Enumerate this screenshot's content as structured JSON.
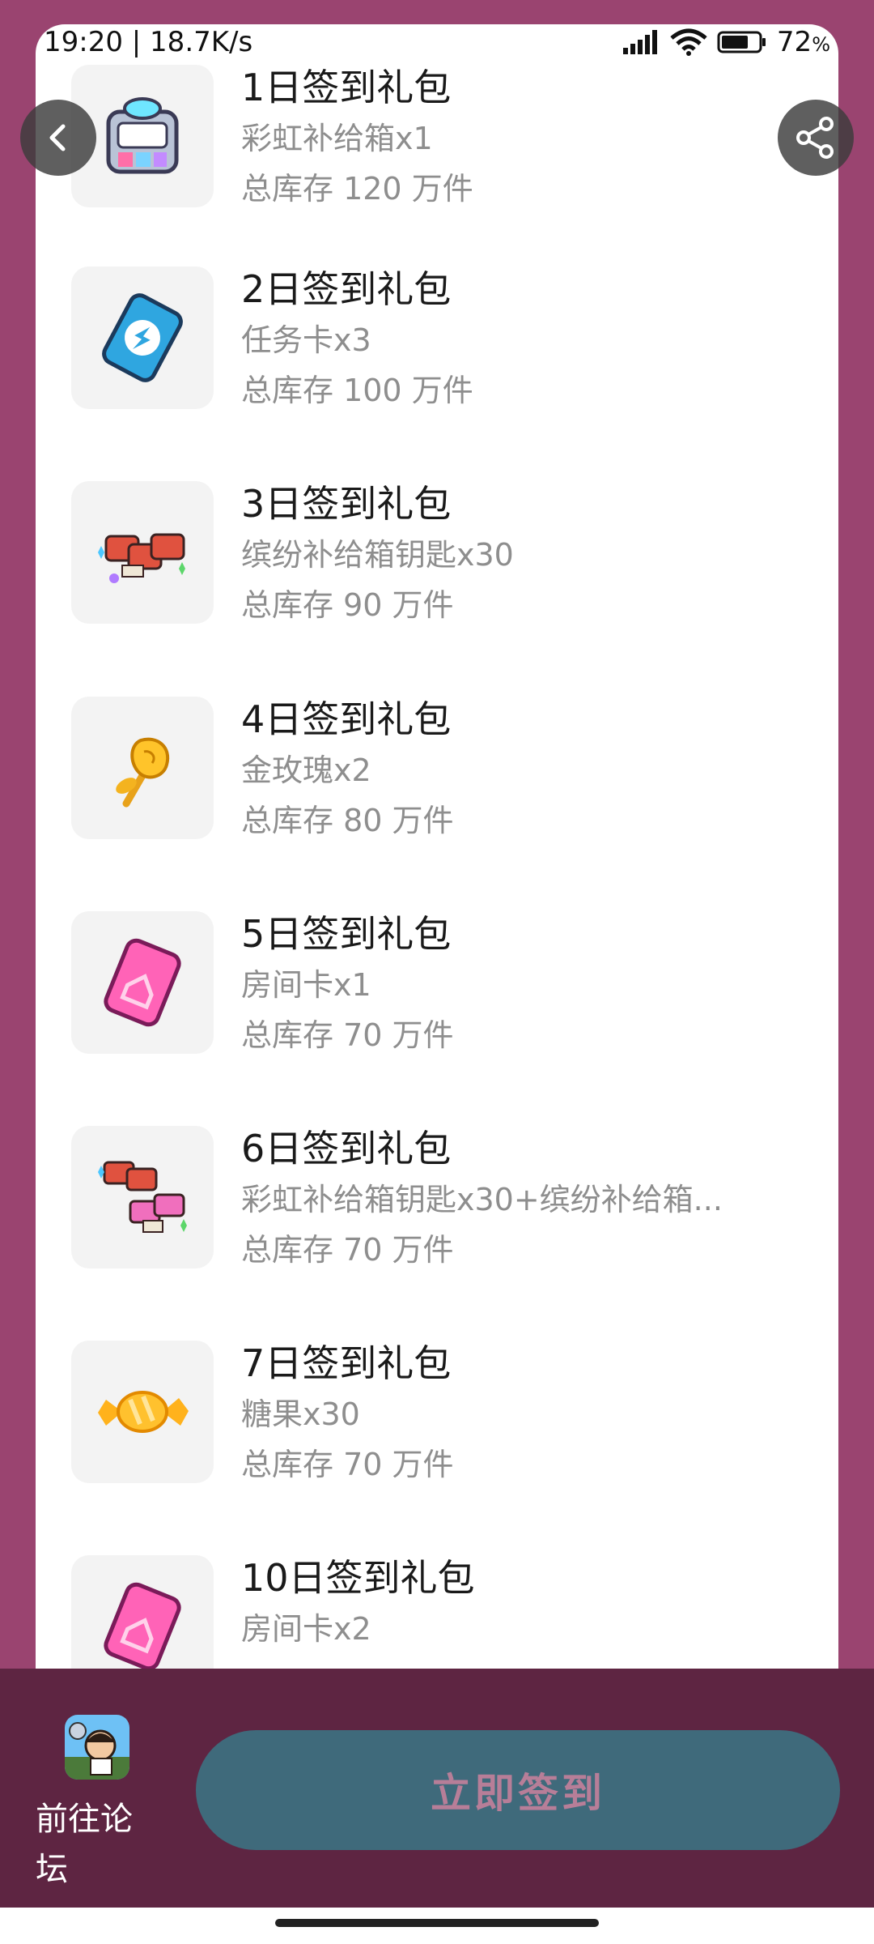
{
  "status_bar": {
    "time_speed": "19:20 | 18.7K/s",
    "battery": "72",
    "battery_unit": "%"
  },
  "gifts": [
    {
      "title": "1日签到礼包",
      "desc": "彩虹补给箱x1",
      "stock": "总库存 120 万件",
      "icon": "rainbow-supply-box-icon"
    },
    {
      "title": "2日签到礼包",
      "desc": "任务卡x3",
      "stock": "总库存 100 万件",
      "icon": "task-card-icon"
    },
    {
      "title": "3日签到礼包",
      "desc": "缤纷补给箱钥匙x30",
      "stock": "总库存 90 万件",
      "icon": "colorful-supply-key-icon"
    },
    {
      "title": "4日签到礼包",
      "desc": "金玫瑰x2",
      "stock": "总库存 80 万件",
      "icon": "golden-rose-icon"
    },
    {
      "title": "5日签到礼包",
      "desc": "房间卡x1",
      "stock": "总库存 70 万件",
      "icon": "room-card-icon"
    },
    {
      "title": "6日签到礼包",
      "desc": "彩虹补给箱钥匙x30+缤纷补给箱...",
      "stock": "总库存 70 万件",
      "icon": "supply-key-bundle-icon"
    },
    {
      "title": "7日签到礼包",
      "desc": "糖果x30",
      "stock": "总库存 70 万件",
      "icon": "candy-icon"
    },
    {
      "title": "10日签到礼包",
      "desc": "房间卡x2",
      "stock": "",
      "icon": "room-card-icon"
    }
  ],
  "bottom": {
    "forum_label": "前往论坛",
    "signin_label": "立即签到"
  },
  "colors": {
    "background": "#9a4470",
    "bottom_bar": "#5e2542",
    "signin_button": "#3f6a7b",
    "signin_text": "#b77e98"
  }
}
